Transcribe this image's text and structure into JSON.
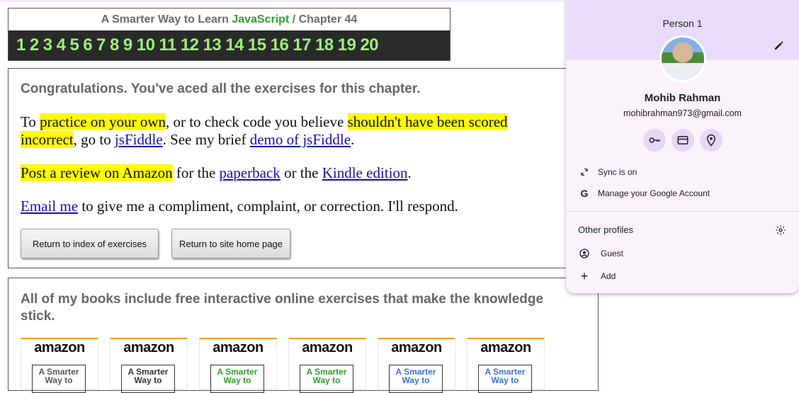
{
  "chapter": {
    "title_prefix": "A Smarter Way to Learn ",
    "title_js": "JavaScript",
    "title_suffix": " / Chapter 44",
    "numbers": [
      "1",
      "2",
      "3",
      "4",
      "5",
      "6",
      "7",
      "8",
      "9",
      "10",
      "11",
      "12",
      "13",
      "14",
      "15",
      "16",
      "17",
      "18",
      "19",
      "20"
    ]
  },
  "main": {
    "congrats": "Congratulations. You've aced all the exercises for this chapter.",
    "p1_a": "To ",
    "p1_hl1": "practice on your own",
    "p1_b": ", or to check code you believe ",
    "p1_hl2": "shouldn't have been scored",
    "p1_hl3": "incorrect",
    "p1_c": ", go to ",
    "p1_link1": "jsFiddle",
    "p1_d": ". See my brief ",
    "p1_link2": "demo of jsFiddle",
    "p1_e": ".",
    "p2_hl": "Post a review on Amazon",
    "p2_a": " for the ",
    "p2_link1": "paperback",
    "p2_b": " or the ",
    "p2_link2": "Kindle edition",
    "p2_c": ".",
    "p3_link": "Email me",
    "p3_a": " to give me a compliment, complaint, or correction. I'll respond.",
    "btn_index": "Return to index of exercises",
    "btn_home": "Return to site home page"
  },
  "books": {
    "heading": "All of my books include free interactive online exercises that make the knowledge stick.",
    "items": [
      {
        "brand": "amazon",
        "line1": "A Smarter",
        "line2": "Way to",
        "color": "#555555"
      },
      {
        "brand": "amazon",
        "line1": "A Smarter",
        "line2": "Way to",
        "color": "#333333"
      },
      {
        "brand": "amazon",
        "line1": "A Smarter",
        "line2": "Way to",
        "color": "#2e9e2e"
      },
      {
        "brand": "amazon",
        "line1": "A Smarter",
        "line2": "Way to",
        "color": "#2e9e2e"
      },
      {
        "brand": "amazon",
        "line1": "A Smarter",
        "line2": "Way to",
        "color": "#3b6fd6"
      },
      {
        "brand": "amazon",
        "line1": "A Smarter",
        "line2": "Way to",
        "color": "#3b6fd6"
      }
    ]
  },
  "profile": {
    "person_label": "Person 1",
    "name": "Mohib Rahman",
    "email": "mohibrahman973@gmail.com",
    "sync": "Sync is on",
    "manage": "Manage your Google Account",
    "other_profiles": "Other profiles",
    "guest": "Guest",
    "add": "Add",
    "icons": [
      "key-icon",
      "card-icon",
      "location-icon"
    ]
  }
}
